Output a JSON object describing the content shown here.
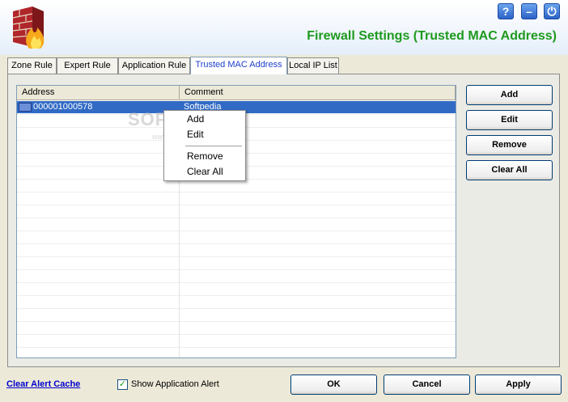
{
  "header": {
    "title": "Firewall Settings (Trusted MAC Address)",
    "window_controls": [
      {
        "name": "help-icon",
        "glyph": "?"
      },
      {
        "name": "minimize-icon",
        "glyph": "–"
      },
      {
        "name": "power-icon",
        "glyph": "⏻"
      }
    ]
  },
  "tabs": [
    {
      "label": "Zone Rule"
    },
    {
      "label": "Expert Rule"
    },
    {
      "label": "Application Rule"
    },
    {
      "label": "Trusted MAC Address",
      "active": true
    },
    {
      "label": "Local IP List"
    }
  ],
  "table": {
    "columns": [
      "Address",
      "Comment"
    ],
    "rows": [
      {
        "address": "000001000578",
        "comment": "Softpedia",
        "selected": true
      }
    ]
  },
  "context_menu": {
    "add": "Add",
    "edit": "Edit",
    "remove": "Remove",
    "clear_all": "Clear All"
  },
  "side_buttons": {
    "add": "Add",
    "edit": "Edit",
    "remove": "Remove",
    "clear_all": "Clear All"
  },
  "footer": {
    "clear_alert_cache": "Clear Alert Cache",
    "show_app_alert": "Show Application Alert",
    "show_app_alert_checked": true,
    "ok": "OK",
    "cancel": "Cancel",
    "apply": "Apply"
  },
  "watermark": {
    "text": "SOFTPEDIA",
    "url": "www.softpedia.com"
  },
  "colors": {
    "title": "#1e9a1e",
    "selection": "#316ac5",
    "active_tab_text": "#1f3fd0",
    "link": "#0000cc"
  }
}
